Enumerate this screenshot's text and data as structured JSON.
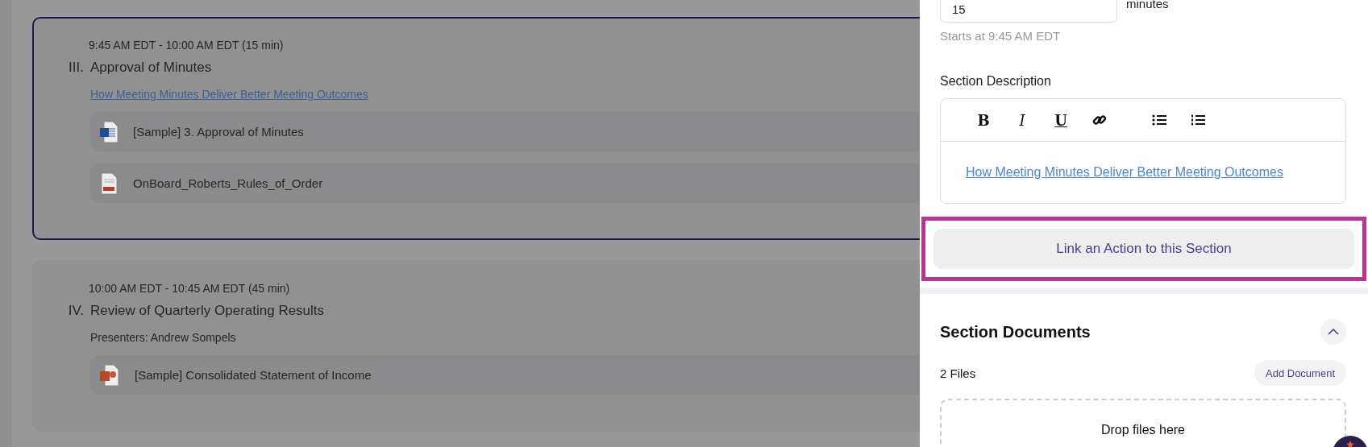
{
  "agenda_sections": [
    {
      "selected": true,
      "time": "9:45 AM EDT - 10:00 AM EDT (15 min)",
      "number": "III.",
      "title": "Approval of Minutes",
      "link": "How Meeting Minutes Deliver Better Meeting Outcomes",
      "files": [
        {
          "kind": "word",
          "name": "[Sample] 3. Approval of Minutes"
        },
        {
          "kind": "pdf",
          "name": "OnBoard_Roberts_Rules_of_Order"
        }
      ]
    },
    {
      "selected": false,
      "time": "10:00 AM EDT - 10:45 AM EDT (45 min)",
      "number": "IV.",
      "title": "Review of Quarterly Operating Results",
      "presenters": "Presenters: Andrew Sompels",
      "files": [
        {
          "kind": "powerpoint",
          "name": "[Sample] Consolidated Statement of Income"
        }
      ]
    }
  ],
  "editor_panel": {
    "duration": {
      "value": "15",
      "unit": "minutes",
      "hint": "Starts at 9:45 AM EDT"
    },
    "description": {
      "label": "Section Description",
      "toolbar": [
        {
          "kind": "bold",
          "glyph": "B"
        },
        {
          "kind": "italic",
          "glyph": "I"
        },
        {
          "kind": "underline",
          "glyph": "U"
        },
        {
          "kind": "link"
        },
        {
          "kind": "bulleted-list"
        },
        {
          "kind": "numbered-list"
        }
      ],
      "link": "How Meeting Minutes Deliver Better Meeting Outcomes"
    },
    "link_action_button": {
      "label": "Link an Action to this Section",
      "highlighted": true
    },
    "documents": {
      "title": "Section Documents",
      "expanded": true,
      "count": "2 Files",
      "add_button": "Add Document",
      "dropzone": "Drop files here"
    }
  }
}
